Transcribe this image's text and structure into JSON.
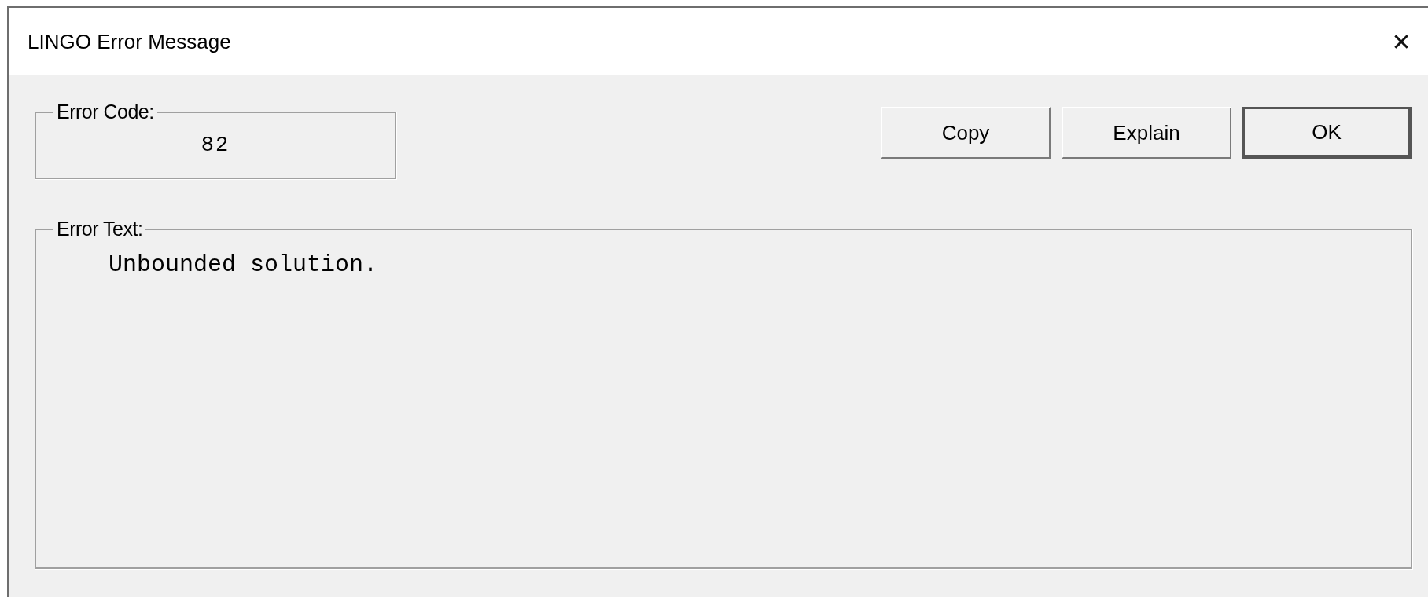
{
  "window": {
    "title": "LINGO Error Message",
    "close": "✕"
  },
  "error_code": {
    "label": "Error Code:",
    "value": "82"
  },
  "buttons": [
    {
      "label": "Copy",
      "default": false
    },
    {
      "label": "Explain",
      "default": false
    },
    {
      "label": "OK",
      "default": true
    }
  ],
  "error_text": {
    "label": "Error Text:",
    "value": "Unbounded solution."
  }
}
